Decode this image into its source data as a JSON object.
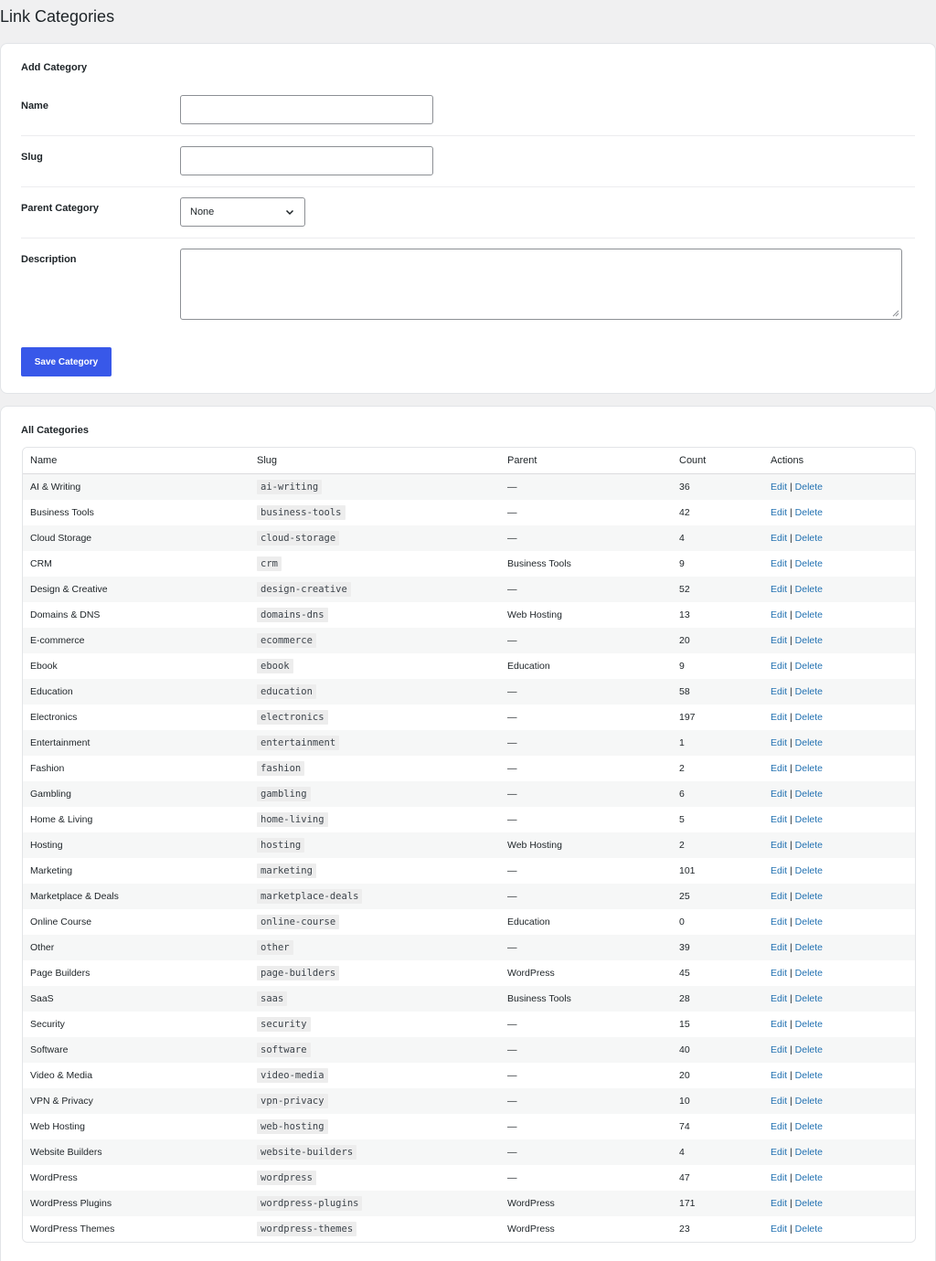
{
  "page": {
    "title": "Link Categories"
  },
  "add_form": {
    "title": "Add Category",
    "name_label": "Name",
    "name_value": "",
    "slug_label": "Slug",
    "slug_value": "",
    "parent_label": "Parent Category",
    "parent_selected": "None",
    "description_label": "Description",
    "description_value": "",
    "save_label": "Save Category"
  },
  "list": {
    "title": "All Categories",
    "columns": {
      "name": "Name",
      "slug": "Slug",
      "parent": "Parent",
      "count": "Count",
      "actions": "Actions"
    },
    "edit_label": "Edit",
    "separator": "|",
    "delete_label": "Delete",
    "rows": [
      {
        "name": "AI & Writing",
        "slug": "ai-writing",
        "parent": "—",
        "count": "36"
      },
      {
        "name": "Business Tools",
        "slug": "business-tools",
        "parent": "—",
        "count": "42"
      },
      {
        "name": "Cloud Storage",
        "slug": "cloud-storage",
        "parent": "—",
        "count": "4"
      },
      {
        "name": "CRM",
        "slug": "crm",
        "parent": "Business Tools",
        "count": "9"
      },
      {
        "name": "Design & Creative",
        "slug": "design-creative",
        "parent": "—",
        "count": "52"
      },
      {
        "name": "Domains & DNS",
        "slug": "domains-dns",
        "parent": "Web Hosting",
        "count": "13"
      },
      {
        "name": "E-commerce",
        "slug": "ecommerce",
        "parent": "—",
        "count": "20"
      },
      {
        "name": "Ebook",
        "slug": "ebook",
        "parent": "Education",
        "count": "9"
      },
      {
        "name": "Education",
        "slug": "education",
        "parent": "—",
        "count": "58"
      },
      {
        "name": "Electronics",
        "slug": "electronics",
        "parent": "—",
        "count": "197"
      },
      {
        "name": "Entertainment",
        "slug": "entertainment",
        "parent": "—",
        "count": "1"
      },
      {
        "name": "Fashion",
        "slug": "fashion",
        "parent": "—",
        "count": "2"
      },
      {
        "name": "Gambling",
        "slug": "gambling",
        "parent": "—",
        "count": "6"
      },
      {
        "name": "Home & Living",
        "slug": "home-living",
        "parent": "—",
        "count": "5"
      },
      {
        "name": "Hosting",
        "slug": "hosting",
        "parent": "Web Hosting",
        "count": "2"
      },
      {
        "name": "Marketing",
        "slug": "marketing",
        "parent": "—",
        "count": "101"
      },
      {
        "name": "Marketplace & Deals",
        "slug": "marketplace-deals",
        "parent": "—",
        "count": "25"
      },
      {
        "name": "Online Course",
        "slug": "online-course",
        "parent": "Education",
        "count": "0"
      },
      {
        "name": "Other",
        "slug": "other",
        "parent": "—",
        "count": "39"
      },
      {
        "name": "Page Builders",
        "slug": "page-builders",
        "parent": "WordPress",
        "count": "45"
      },
      {
        "name": "SaaS",
        "slug": "saas",
        "parent": "Business Tools",
        "count": "28"
      },
      {
        "name": "Security",
        "slug": "security",
        "parent": "—",
        "count": "15"
      },
      {
        "name": "Software",
        "slug": "software",
        "parent": "—",
        "count": "40"
      },
      {
        "name": "Video & Media",
        "slug": "video-media",
        "parent": "—",
        "count": "20"
      },
      {
        "name": "VPN & Privacy",
        "slug": "vpn-privacy",
        "parent": "—",
        "count": "10"
      },
      {
        "name": "Web Hosting",
        "slug": "web-hosting",
        "parent": "—",
        "count": "74"
      },
      {
        "name": "Website Builders",
        "slug": "website-builders",
        "parent": "—",
        "count": "4"
      },
      {
        "name": "WordPress",
        "slug": "wordpress",
        "parent": "—",
        "count": "47"
      },
      {
        "name": "WordPress Plugins",
        "slug": "wordpress-plugins",
        "parent": "WordPress",
        "count": "171"
      },
      {
        "name": "WordPress Themes",
        "slug": "wordpress-themes",
        "parent": "WordPress",
        "count": "23"
      }
    ]
  },
  "colors": {
    "accent": "#3858e9",
    "link": "#2271b1",
    "background": "#f0f0f1"
  },
  "icons": {
    "select_chevron": "chevron-down-icon"
  }
}
